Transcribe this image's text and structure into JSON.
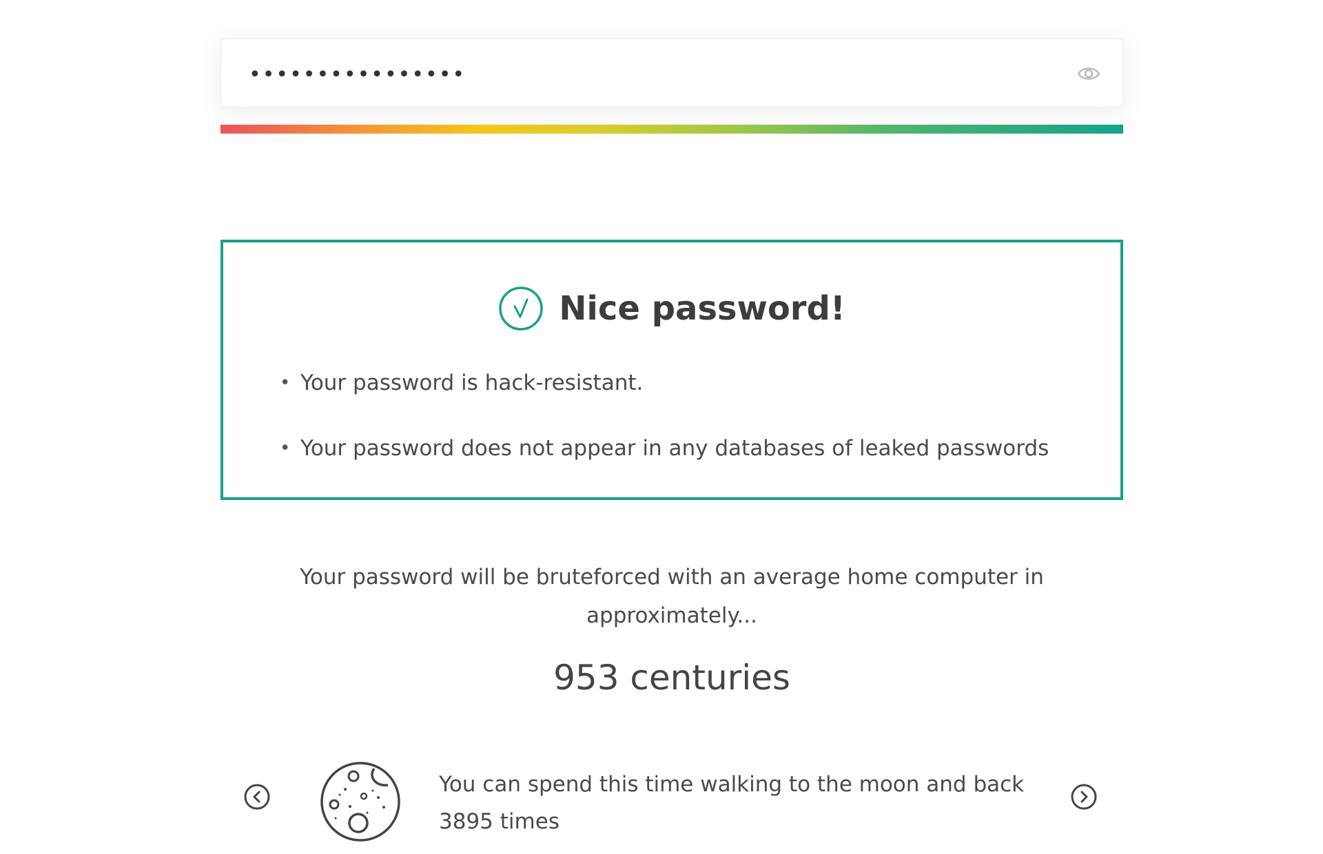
{
  "password": {
    "masked_value": "••••••••••••••••",
    "toggle_icon": "eye-icon"
  },
  "strength": {
    "colors": [
      "#e8545f",
      "#f28c3e",
      "#f6c51c",
      "#9bc74a",
      "#14a38c"
    ]
  },
  "verdict": {
    "icon": "check-circle-icon",
    "title": "Nice password!",
    "accent_color": "#1aa089",
    "items": [
      "Your password is hack-resistant.",
      "Your password does not appear in any databases of leaked passwords"
    ]
  },
  "bruteforce": {
    "text": "Your password will be bruteforced with an average home computer in approximately...",
    "time": "953 centuries"
  },
  "fact": {
    "icon": "moon-icon",
    "prev_icon": "chevron-left-circle-icon",
    "next_icon": "chevron-right-circle-icon",
    "text": "You can spend this time walking to the moon and back 3895 times"
  }
}
